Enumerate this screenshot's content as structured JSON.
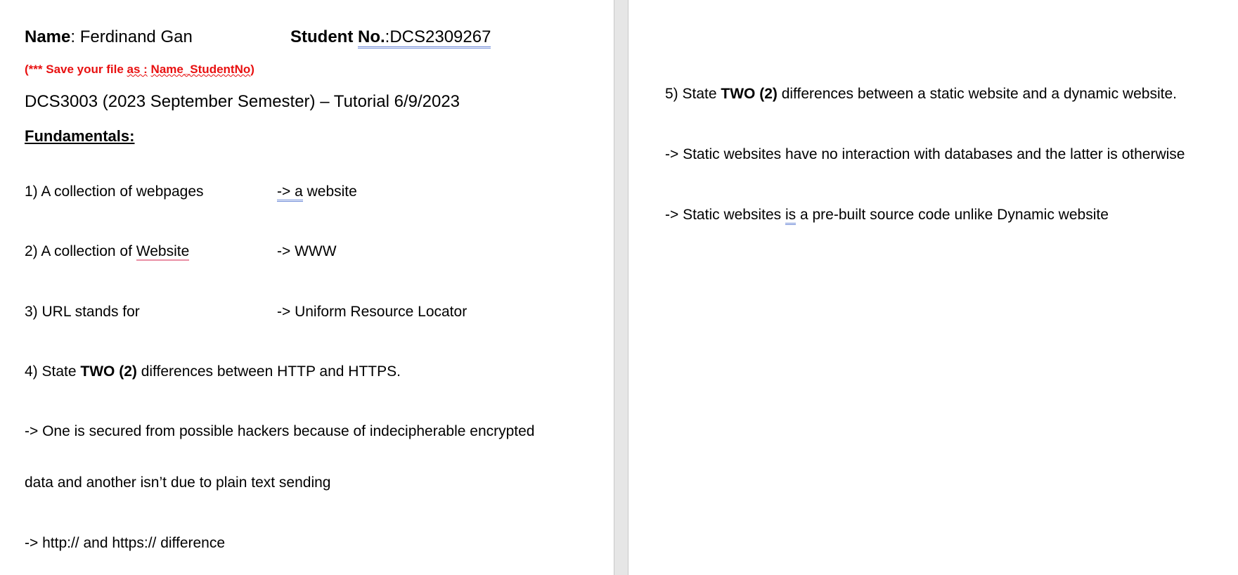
{
  "page1": {
    "name_label": "Name",
    "name_value": ": Ferdinand Gan",
    "student_label": "Student ",
    "student_no_label": "No.",
    "student_no_value": ":DCS2309267",
    "save_note_a": "(*** Save your file ",
    "save_note_b": "as :",
    "save_note_c": " ",
    "save_note_d": "Name_StudentNo",
    "save_note_e": ")",
    "course_line": "DCS3003 (2023 September Semester) – Tutorial 6/9/2023",
    "section_heading": "Fundamentals:",
    "q1_text": "1) A collection of webpages",
    "q1_arrow": "->",
    "q1_answer_a": " a",
    "q1_answer_b": " website",
    "q2_text_a": "2) A collection of ",
    "q2_text_b": "Website",
    "q2_answer": "-> WWW",
    "q3_text": "3) URL stands for",
    "q3_answer": "-> Uniform Resource Locator",
    "q4_a": "4) State ",
    "q4_b": "TWO (2)",
    "q4_c": " differences between HTTP and HTTPS.",
    "q4_ans1_line1": "-> One is secured from possible hackers because of indecipherable encrypted",
    "q4_ans1_line2": "data and another isn’t due to plain text sending",
    "q4_ans2": "-> http:// and https:// difference"
  },
  "page2": {
    "q5_a": "5) State ",
    "q5_b": "TWO (2)",
    "q5_c": " differences between a static website and a dynamic website.",
    "q5_ans1": "-> Static websites have no interaction with databases and the latter is otherwise",
    "q5_ans2_a": "-> Static websites ",
    "q5_ans2_b": "is",
    "q5_ans2_c": " a pre-built source code unlike Dynamic website"
  }
}
